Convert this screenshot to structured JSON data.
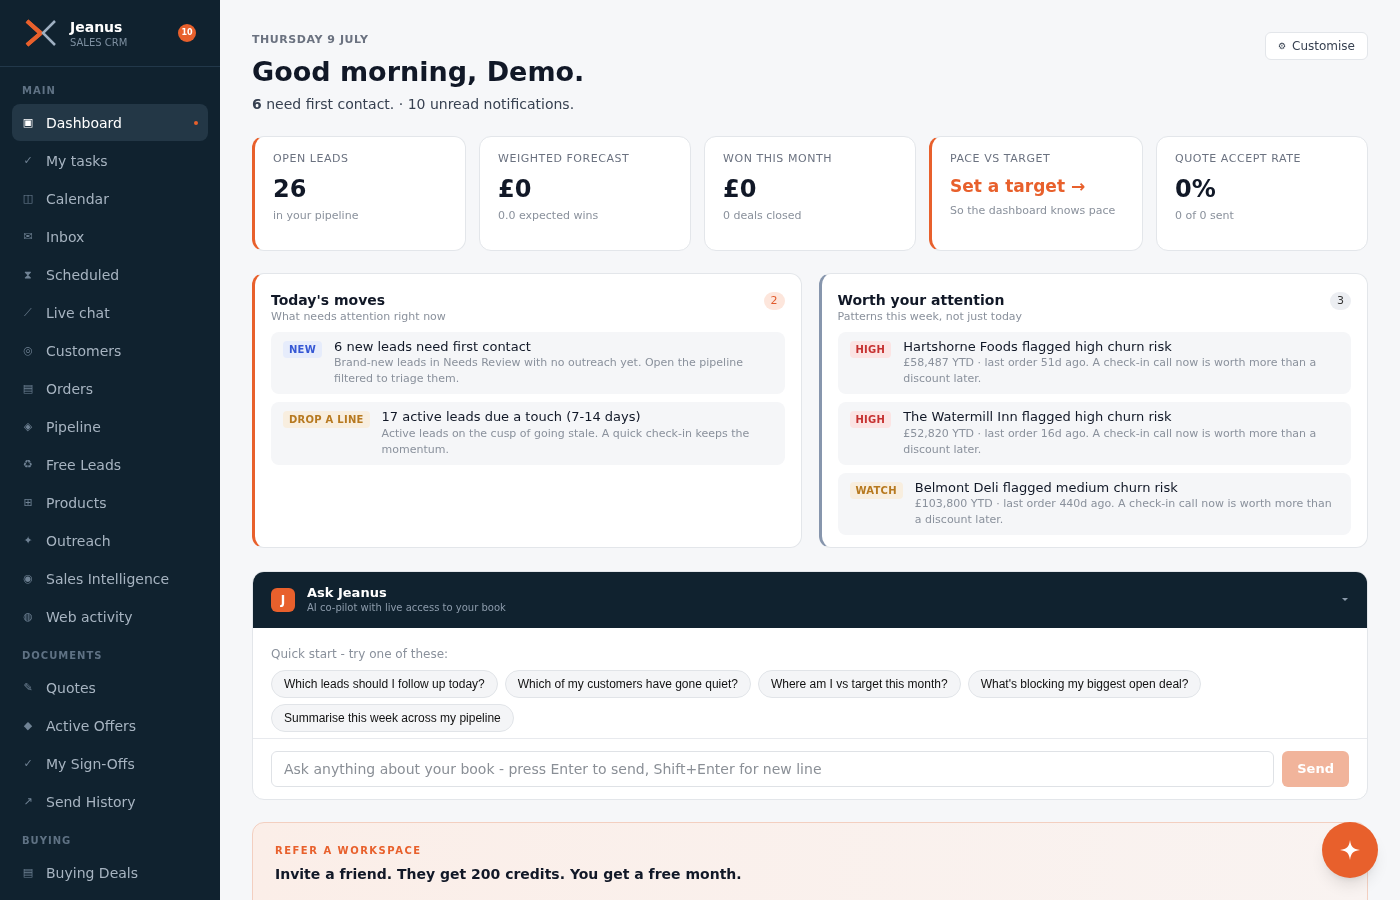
{
  "sidebar": {
    "brand": {
      "name": "Jeanus",
      "tagline": "SALES CRM",
      "notifications": "10"
    },
    "sections": [
      {
        "title": "MAIN",
        "items": [
          {
            "icon": "▣",
            "label": "Dashboard",
            "selected": true
          },
          {
            "icon": "✓",
            "label": "My tasks",
            "selected": false
          },
          {
            "icon": "◫",
            "label": "Calendar",
            "selected": false
          },
          {
            "icon": "✉",
            "label": "Inbox",
            "selected": false
          },
          {
            "icon": "⧗",
            "label": "Scheduled",
            "selected": false
          },
          {
            "icon": "⟋",
            "label": "Live chat",
            "selected": false
          },
          {
            "icon": "◎",
            "label": "Customers",
            "selected": false
          },
          {
            "icon": "▤",
            "label": "Orders",
            "selected": false
          },
          {
            "icon": "◈",
            "label": "Pipeline",
            "selected": false
          },
          {
            "icon": "♻",
            "label": "Free Leads",
            "selected": false
          },
          {
            "icon": "⊞",
            "label": "Products",
            "selected": false
          },
          {
            "icon": "✦",
            "label": "Outreach",
            "selected": false
          },
          {
            "icon": "◉",
            "label": "Sales Intelligence",
            "selected": false
          },
          {
            "icon": "◍",
            "label": "Web activity",
            "selected": false
          }
        ]
      },
      {
        "title": "DOCUMENTS",
        "items": [
          {
            "icon": "✎",
            "label": "Quotes",
            "selected": false
          },
          {
            "icon": "◆",
            "label": "Active Offers",
            "selected": false
          },
          {
            "icon": "✓",
            "label": "My Sign-Offs",
            "selected": false
          },
          {
            "icon": "↗",
            "label": "Send History",
            "selected": false
          }
        ]
      },
      {
        "title": "BUYING",
        "items": [
          {
            "icon": "▤",
            "label": "Buying Deals",
            "selected": false
          }
        ]
      }
    ]
  },
  "header": {
    "date": "THURSDAY 9 JULY",
    "greeting": "Good morning, Demo.",
    "summary": "**6** need first contact. · 10 unread notifications.",
    "customise": {
      "icon": "⚙",
      "label": "Customise"
    }
  },
  "stats": [
    {
      "label": "OPEN LEADS",
      "value": "26",
      "note": "in your pipeline",
      "accent": true,
      "kind": "value"
    },
    {
      "label": "WEIGHTED FORECAST",
      "value": "£0",
      "note": "0.0 expected wins",
      "accent": false,
      "kind": "value"
    },
    {
      "label": "WON THIS MONTH",
      "value": "£0",
      "note": "0 deals closed",
      "accent": false,
      "kind": "value"
    },
    {
      "label": "PACE VS TARGET",
      "value": "Set a target →",
      "note": "So the dashboard knows pace",
      "accent": true,
      "kind": "link"
    },
    {
      "label": "QUOTE ACCEPT RATE",
      "value": "0%",
      "note": "0 of 0 sent",
      "accent": false,
      "kind": "value"
    }
  ],
  "panels": [
    {
      "title": "Today's moves",
      "subtitle": "What needs attention right now",
      "count": "2",
      "kind": "accent",
      "items": [
        {
          "tag": "NEW",
          "kind": "new",
          "title": "6 new leads need first contact",
          "detail": "Brand-new leads in Needs Review with no outreach yet. Open the pipeline filtered to triage them."
        },
        {
          "tag": "DROP A LINE",
          "kind": "drop",
          "title": "17 active leads due a touch (7-14 days)",
          "detail": "Active leads on the cusp of going stale. A quick check-in keeps the momentum."
        }
      ]
    },
    {
      "title": "Worth your attention",
      "subtitle": "Patterns this week, not just today",
      "count": "3",
      "kind": "muted",
      "items": [
        {
          "tag": "HIGH",
          "kind": "high",
          "title": "Hartshorne Foods flagged high churn risk",
          "detail": "£58,487 YTD · last order 51d ago. A check-in call now is worth more than a discount later."
        },
        {
          "tag": "HIGH",
          "kind": "high",
          "title": "The Watermill Inn flagged high churn risk",
          "detail": "£52,820 YTD · last order 16d ago. A check-in call now is worth more than a discount later."
        },
        {
          "tag": "WATCH",
          "kind": "watch",
          "title": "Belmont Deli flagged medium churn risk",
          "detail": "£103,800 YTD · last order 440d ago. A check-in call now is worth more than a discount later."
        }
      ]
    }
  ],
  "assistant": {
    "avatar": "J",
    "title": "Ask Jeanus",
    "subtitle": "AI co-pilot with live access to your book",
    "expanded": true,
    "quick_start": "Quick start - try one of these:",
    "suggestions": [
      "Which leads should I follow up today?",
      "Which of my customers have gone quiet?",
      "Where am I vs target this month?",
      "What's blocking my biggest open deal?",
      "Summarise this week across my pipeline"
    ],
    "placeholder": "Ask anything about your book - press Enter to send, Shift+Enter for new line",
    "send": {
      "label": "Send",
      "disabled": true
    }
  },
  "referral": {
    "eyebrow": "REFER A WORKSPACE",
    "title": "Invite a friend. They get 200 credits. You get a free month."
  }
}
